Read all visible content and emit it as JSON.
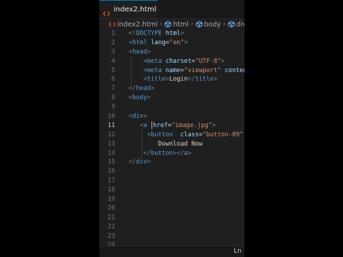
{
  "tab": {
    "label": "index2.html",
    "icon": "html-file-icon"
  },
  "breadcrumb": [
    {
      "label": "index2.html",
      "icon": "html-file-icon"
    },
    {
      "label": "html",
      "icon": "element-icon"
    },
    {
      "label": "body",
      "icon": "element-icon"
    },
    {
      "label": "div",
      "icon": "element-icon"
    }
  ],
  "line_numbers": [
    "1",
    "2",
    "3",
    "4",
    "5",
    "6",
    "7",
    "8",
    "9",
    "10",
    "11",
    "12",
    "13",
    "14",
    "15",
    "16",
    "17",
    "18",
    "19",
    "20",
    "21",
    "22",
    "23",
    "24"
  ],
  "active_line": "11",
  "code": {
    "l1": {
      "open": "<!",
      "kw": "DOCTYPE",
      "sp": " ",
      "val": "html",
      "close": ">"
    },
    "l2": {
      "open": "<",
      "tag": "html",
      "attr": " lang",
      "eq": "=",
      "val": "\"en\"",
      "close": ">"
    },
    "l3": {
      "open": "<",
      "tag": "head",
      "close": ">"
    },
    "l4": {
      "open": "<",
      "tag": "meta",
      "attr": " charset",
      "eq": "=",
      "val": "\"UTF-8\"",
      "close": ">"
    },
    "l5": {
      "open": "<",
      "tag": "meta",
      "attr": " name",
      "eq": "=",
      "val": "\"viewport\"",
      "attr2": " conten"
    },
    "l6": {
      "open": "<",
      "tag": "title",
      "close": ">",
      "text": "Login",
      "open2": "</",
      "tag2": "title",
      "close2": ">"
    },
    "l7": {
      "open": "</",
      "tag": "head",
      "close": ">"
    },
    "l8": {
      "open": "<",
      "tag": "body",
      "close": ">"
    },
    "l10": {
      "open": "<",
      "tag": "div",
      "close": ">"
    },
    "l11": {
      "open": "<",
      "tag": "a",
      "attr": "href",
      "eq": "=",
      "val": "\"image.jpg\"",
      "close": ">"
    },
    "l12": {
      "open": "<",
      "tag": "button",
      "attr": "  class",
      "eq": "=",
      "val": "\"button-89\""
    },
    "l13": {
      "text": "Download Now"
    },
    "l14": {
      "open": "</",
      "tag": "button",
      "close": ">",
      "open2": "</",
      "tag2": "a",
      "close2": ">"
    },
    "l15": {
      "open": "</",
      "tag": "div",
      "close": ">"
    }
  },
  "status": {
    "ln": "Ln"
  },
  "colors": {
    "tag": "#569cd6",
    "attr": "#9cdcfe",
    "string": "#ce9178",
    "punct": "#808080",
    "text": "#d4d4d4",
    "accent": "#0078d4",
    "html_icon": "#e44d26"
  }
}
